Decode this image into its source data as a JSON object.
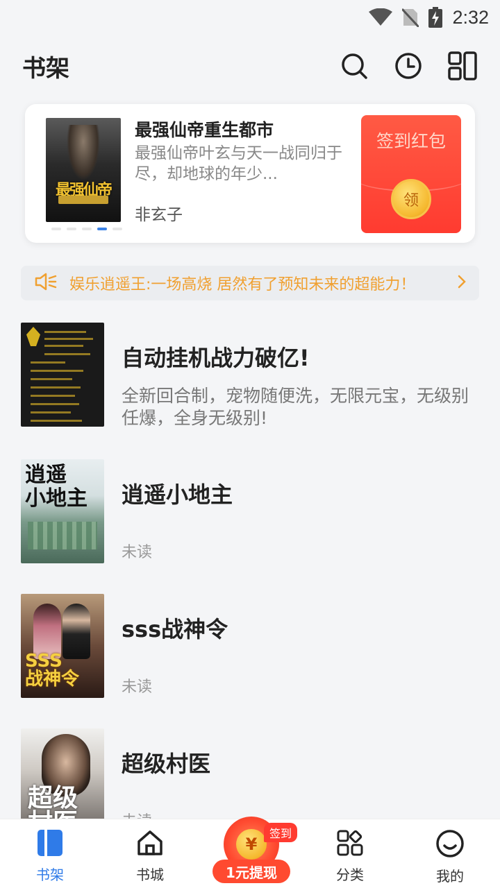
{
  "status_bar": {
    "time": "2:32"
  },
  "header": {
    "title": "书架"
  },
  "featured": {
    "title": "最强仙帝重生都市",
    "description": "最强仙帝叶玄与天一战同归于尽，却地球的年少...",
    "author": "非玄子",
    "cover_text": "最强仙帝",
    "carousel_count": 5,
    "carousel_active": 4
  },
  "redpacket": {
    "label": "签到红包",
    "coin_text": "领"
  },
  "notice": {
    "text": "娱乐逍遥王:一场高烧 居然有了预知未来的超能力！"
  },
  "books": [
    {
      "title": "自动挂机战力破亿!",
      "desc": "全新回合制，宠物随便洗，无限元宝，无级别任爆，全身无级别!"
    },
    {
      "title": "逍遥小地主",
      "status": "未读",
      "cover_text": "逍遥\n小地主"
    },
    {
      "title": "sss战神令",
      "status": "未读",
      "cover_text": "SSS\n战神令"
    },
    {
      "title": "超级村医",
      "status": "未读",
      "cover_text": "超级\n村医"
    }
  ],
  "bottom_nav": {
    "bookshelf": "书架",
    "bookstore": "书城",
    "center_label": "1元提现",
    "center_coin": "¥",
    "sign_badge": "签到",
    "category": "分类",
    "mine": "我的"
  },
  "colors": {
    "accent": "#2f7be8",
    "notice": "#f0a030",
    "red": "#ff3b30"
  }
}
